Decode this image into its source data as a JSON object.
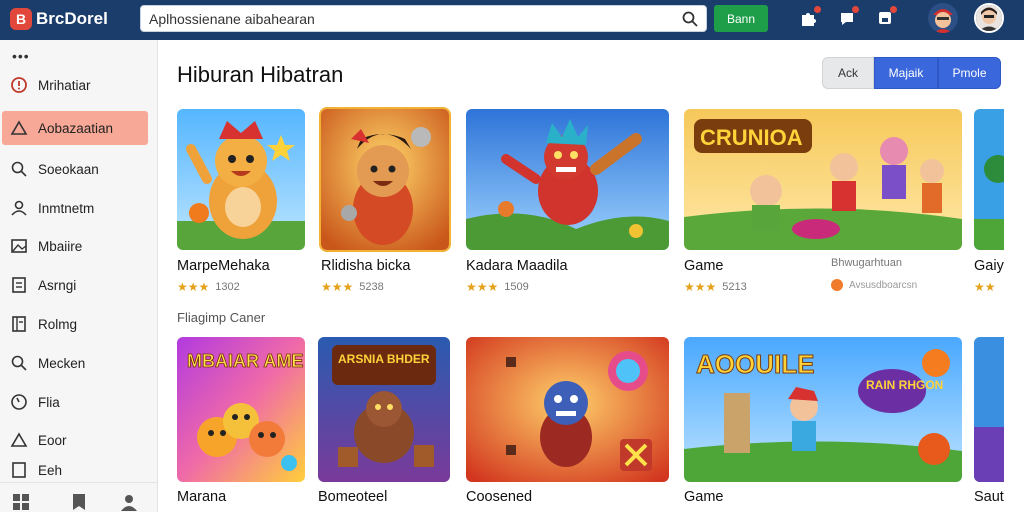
{
  "app": {
    "brand": "BrcDorel",
    "brand_mark": "B"
  },
  "search": {
    "value": "Aplhossienane aibahearan",
    "button_label": "Bann"
  },
  "header_icons": [
    "puzzle-icon",
    "notification-icon",
    "save-icon"
  ],
  "sidebar": {
    "more": "•••",
    "items": [
      {
        "label": "Mrihatiar",
        "icon": "alert-icon"
      },
      {
        "label": "Aobazaatian",
        "icon": "triangle-icon",
        "active": true
      },
      {
        "label": "Soeokaan",
        "icon": "search-icon"
      },
      {
        "label": "Inmtnetm",
        "icon": "user-icon"
      },
      {
        "label": "Mbaiire",
        "icon": "image-icon"
      },
      {
        "label": "Asrngi",
        "icon": "document-icon"
      },
      {
        "label": "Rolmg",
        "icon": "book-icon"
      },
      {
        "label": "Mecken",
        "icon": "search-icon"
      },
      {
        "label": "Flia",
        "icon": "clock-icon"
      },
      {
        "label": "Eoor",
        "icon": "warning-icon"
      },
      {
        "label": "Eeh",
        "icon": "document-icon"
      }
    ],
    "bottom_icons": [
      "grid-icon",
      "bookmark-icon",
      "profile-icon"
    ]
  },
  "main": {
    "title": "Hiburan Hibatran",
    "segments": [
      "Ack",
      "Majaik",
      "Pmole"
    ],
    "section_label": "Fliagimp Caner",
    "row1": [
      {
        "title": "MarpeMehaka",
        "rating": 3,
        "count": "1302"
      },
      {
        "title": "Rlidisha bicka",
        "rating": 3,
        "count": "5238",
        "highlight": true
      },
      {
        "title": "Kadara Maadila",
        "rating": 3,
        "count": "1509"
      },
      {
        "title": "Game",
        "rating": 3,
        "count": "5213",
        "banner": "CRUNIOA"
      },
      {
        "title": "Gaiy",
        "rating": 2,
        "count": ""
      }
    ],
    "row1_extra": {
      "sub_brand": "Bhwugarhtuan",
      "publisher": "Avsusdboarcsn"
    },
    "row2": [
      {
        "title": "Marana",
        "banner": "MBAIAR AME"
      },
      {
        "title": "Bomeoteel",
        "banner": "ARSNIA BHDER"
      },
      {
        "title": "Coosened"
      },
      {
        "title": "Game",
        "banner": "AOOUILE",
        "badge": "RAIN RHGON"
      },
      {
        "title": "Saut"
      }
    ]
  },
  "colors": {
    "topbar": "#1b3d6b",
    "accent_blue": "#3a68dc",
    "search_button": "#1f9e4a",
    "active_item": "#f7a896",
    "star": "#e5a11a"
  }
}
